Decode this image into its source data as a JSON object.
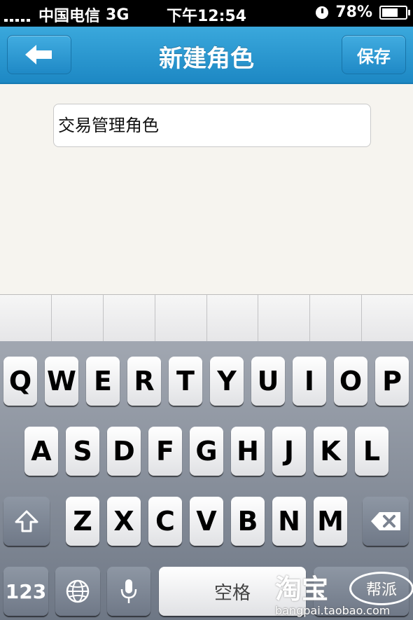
{
  "status_bar": {
    "carrier": "中国电信",
    "network": "3G",
    "time": "下午12:54",
    "battery": "78%",
    "battery_level": 0.78
  },
  "nav": {
    "title": "新建角色",
    "save_label": "保存",
    "back_icon": "back-arrow-icon"
  },
  "form": {
    "role_name_value": "交易管理角色"
  },
  "keyboard": {
    "row1": [
      "Q",
      "W",
      "E",
      "R",
      "T",
      "Y",
      "U",
      "I",
      "O",
      "P"
    ],
    "row2": [
      "A",
      "S",
      "D",
      "F",
      "G",
      "H",
      "J",
      "K",
      "L"
    ],
    "row3": [
      "Z",
      "X",
      "C",
      "V",
      "B",
      "N",
      "M"
    ],
    "numbers_label": "123",
    "space_label": "空格"
  },
  "watermark": {
    "brand": "淘宝",
    "bubble": "帮派",
    "url": "bangpai.taobao.com"
  }
}
